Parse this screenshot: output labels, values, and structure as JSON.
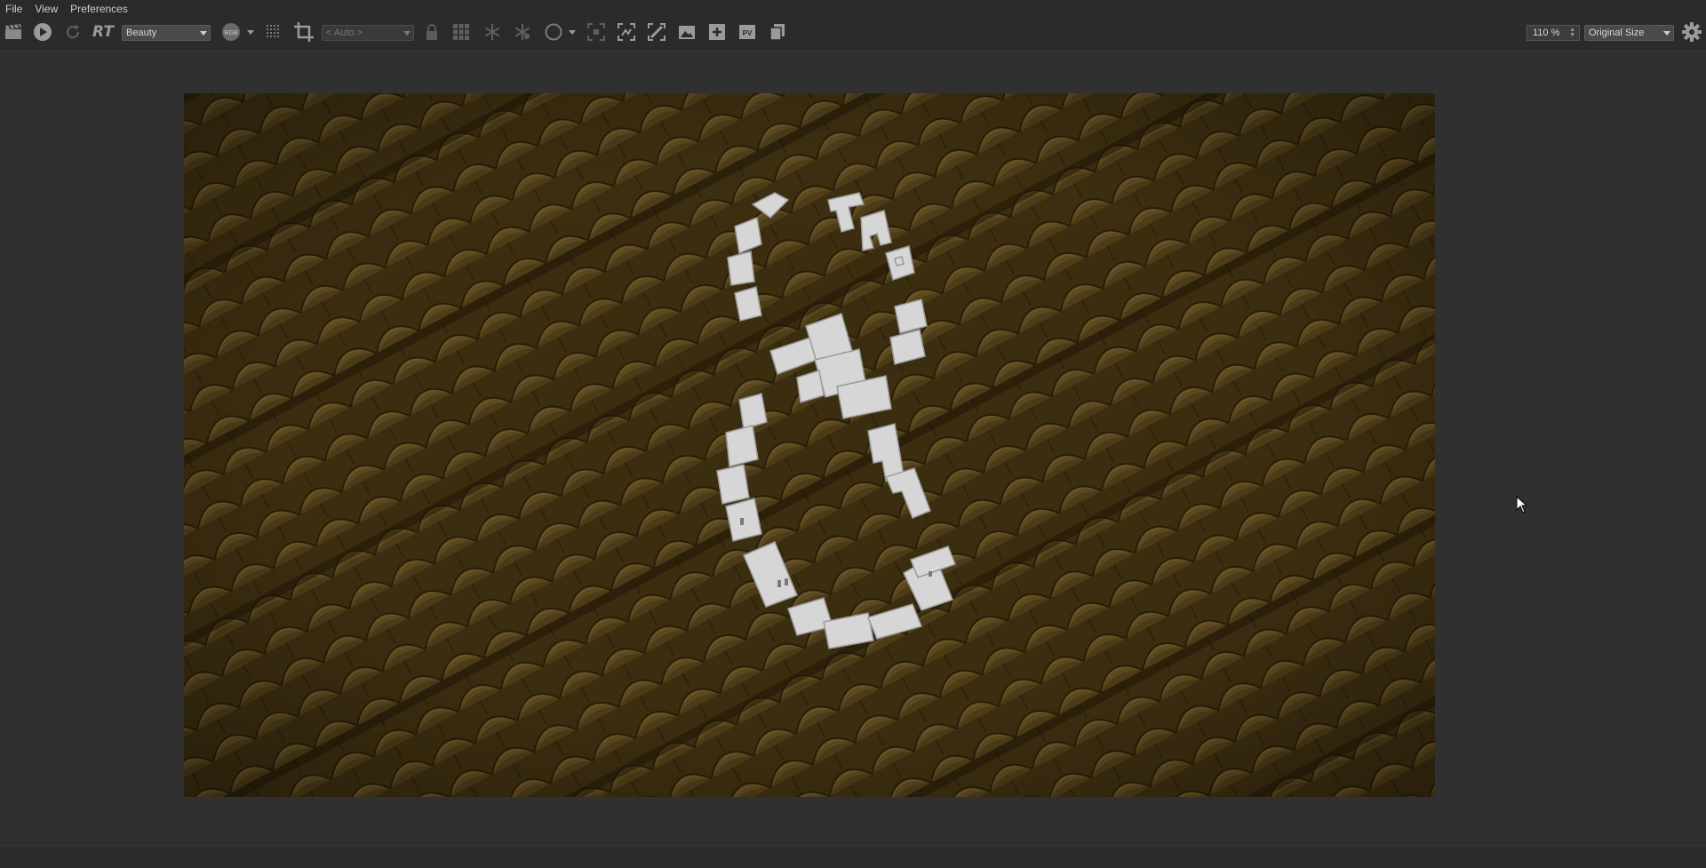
{
  "menu": {
    "file": "File",
    "view": "View",
    "preferences": "Preferences"
  },
  "toolbar": {
    "rt_label": "RT",
    "pass_select": "Beauty",
    "channel_badge": "RGB",
    "region_select": "< Auto >",
    "zoom_value": "110 %",
    "size_select": "Original Size"
  },
  "colors": {
    "background": "#303030",
    "toolbar": "#2b2b2b",
    "render_dark": "#3b2d10",
    "render_light": "#6a5526",
    "letters": "#d6d6d6"
  },
  "render": {
    "text": "THE SMALL GIRL"
  }
}
